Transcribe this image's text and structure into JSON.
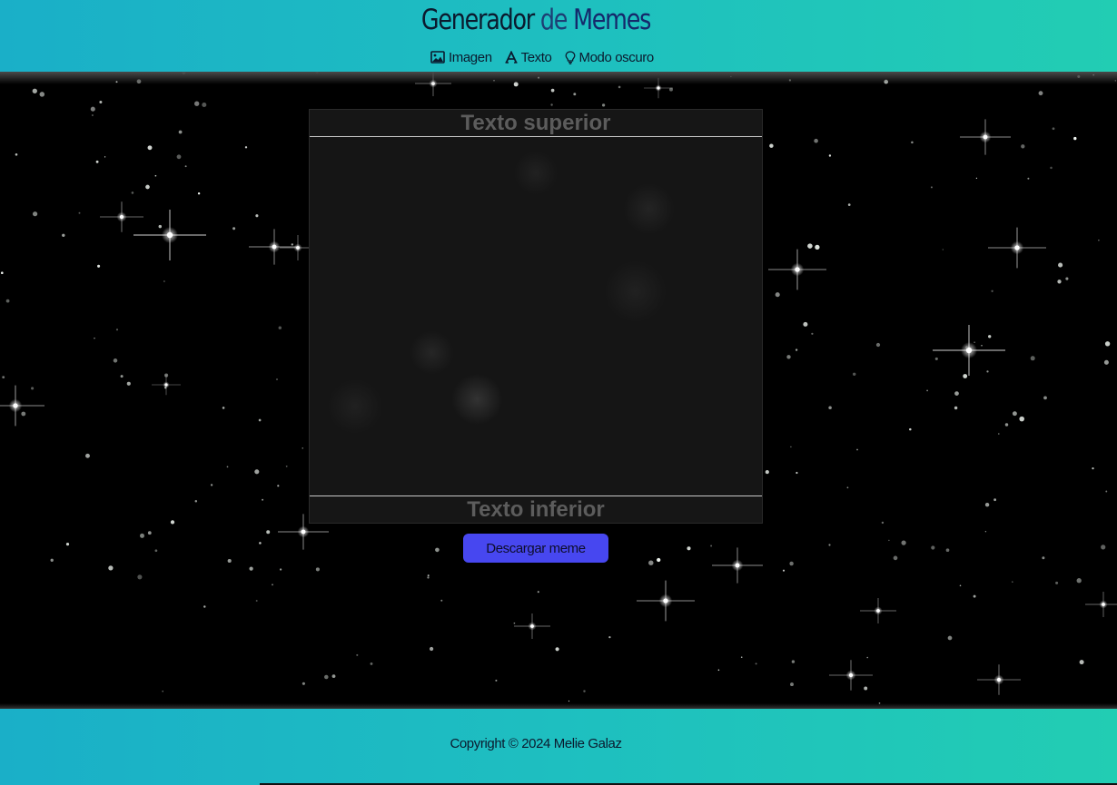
{
  "header": {
    "title_part1": "Generador",
    "title_part2": "de",
    "title_part3": "Memes",
    "nav": [
      {
        "label": "Imagen",
        "icon": "image-icon"
      },
      {
        "label": "Texto",
        "icon": "text-icon"
      },
      {
        "label": "Modo oscuro",
        "icon": "lightbulb-icon"
      }
    ]
  },
  "meme": {
    "top_text": "Texto superior",
    "bottom_text": "Texto inferior"
  },
  "download": {
    "label": "Descargar meme"
  },
  "footer": {
    "copyright": "Copyright © 2024 Melie Galaz"
  },
  "colors": {
    "header_gradient_start": "#1aafc8",
    "header_gradient_end": "#22cdb3",
    "button": "#4747f0",
    "background": "#000000"
  }
}
